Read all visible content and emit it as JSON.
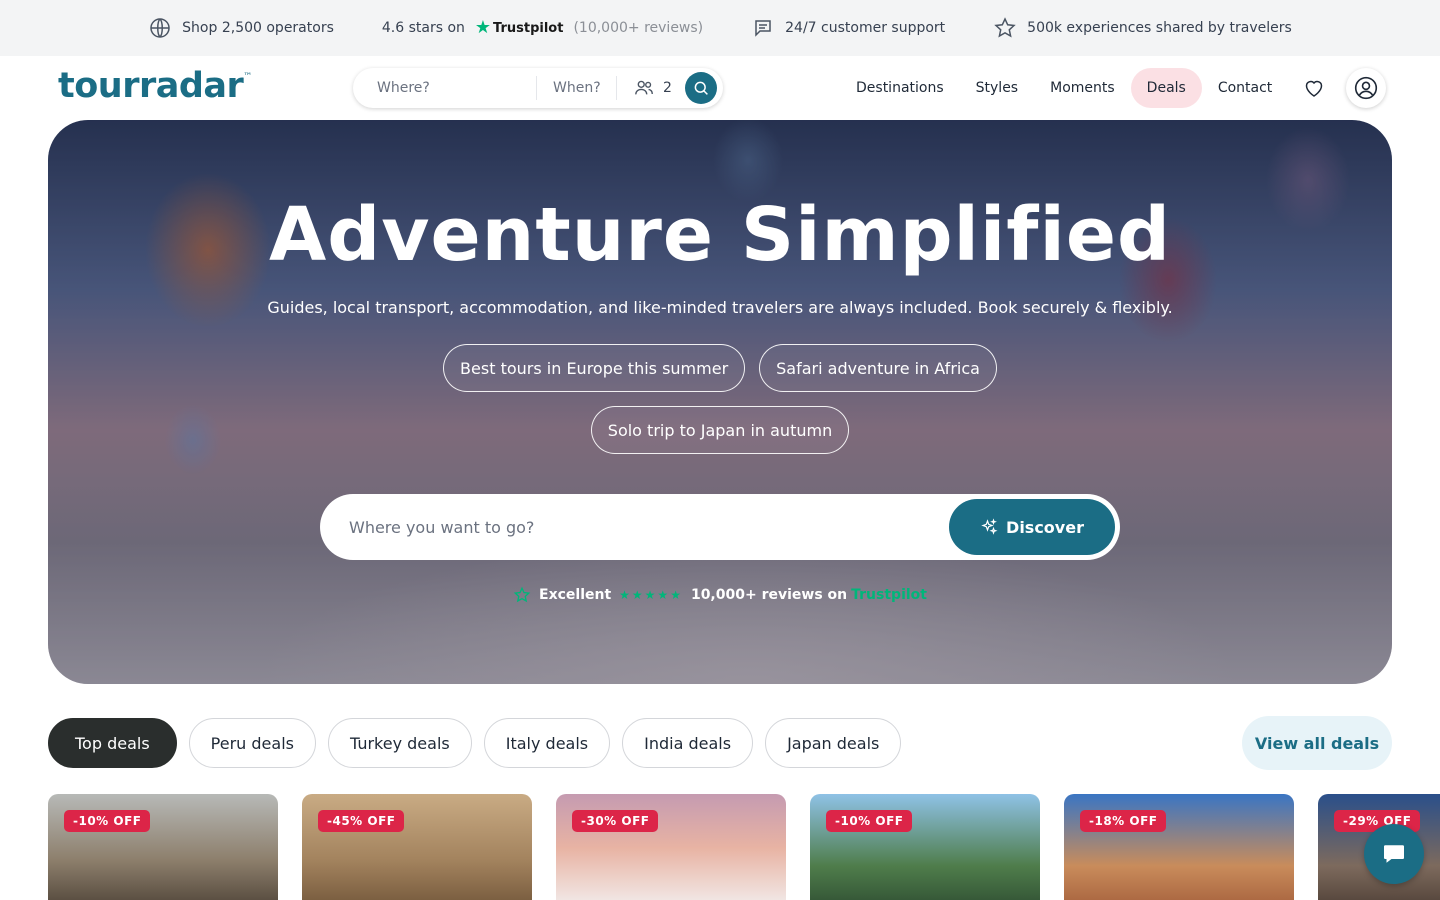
{
  "topbar": {
    "operators": "Shop 2,500 operators",
    "stars_prefix": "4.6 stars on",
    "trustpilot": "Trustpilot",
    "reviews": "(10,000+ reviews)",
    "support": "24/7 customer support",
    "experiences": "500k experiences shared by travelers"
  },
  "header": {
    "logo": "tourradar",
    "logo_tm": "™",
    "search": {
      "where_placeholder": "Where?",
      "when_placeholder": "When?",
      "guests": "2"
    },
    "nav": [
      "Destinations",
      "Styles",
      "Moments",
      "Deals",
      "Contact"
    ]
  },
  "hero": {
    "title": "Adventure Simplified",
    "subtitle": "Guides, local transport, accommodation, and like-minded travelers are always included. Book securely & flexibly.",
    "chips": [
      "Best tours in Europe this summer",
      "Safari adventure in Africa",
      "Solo trip to Japan in autumn"
    ],
    "search_placeholder": "Where you want to go?",
    "discover": "Discover",
    "rating": {
      "label": "Excellent",
      "stars": "★★★★★",
      "reviews": "10,000+ reviews on",
      "brand": "Trustpilot"
    }
  },
  "deals": {
    "filters": [
      "Top deals",
      "Peru deals",
      "Turkey deals",
      "Italy deals",
      "India deals",
      "Japan deals"
    ],
    "active_filter": "Top deals",
    "view_all": "View all deals",
    "cards": [
      {
        "badge": "-10% OFF"
      },
      {
        "badge": "-45% OFF"
      },
      {
        "badge": "-30% OFF"
      },
      {
        "badge": "-10% OFF"
      },
      {
        "badge": "-18% OFF"
      },
      {
        "badge": "-29% OFF"
      }
    ]
  },
  "colors": {
    "brand": "#1b6d85",
    "deal_badge": "#dc2548",
    "trustpilot_green": "#00b67a",
    "deals_highlight": "#fbe0e4"
  }
}
